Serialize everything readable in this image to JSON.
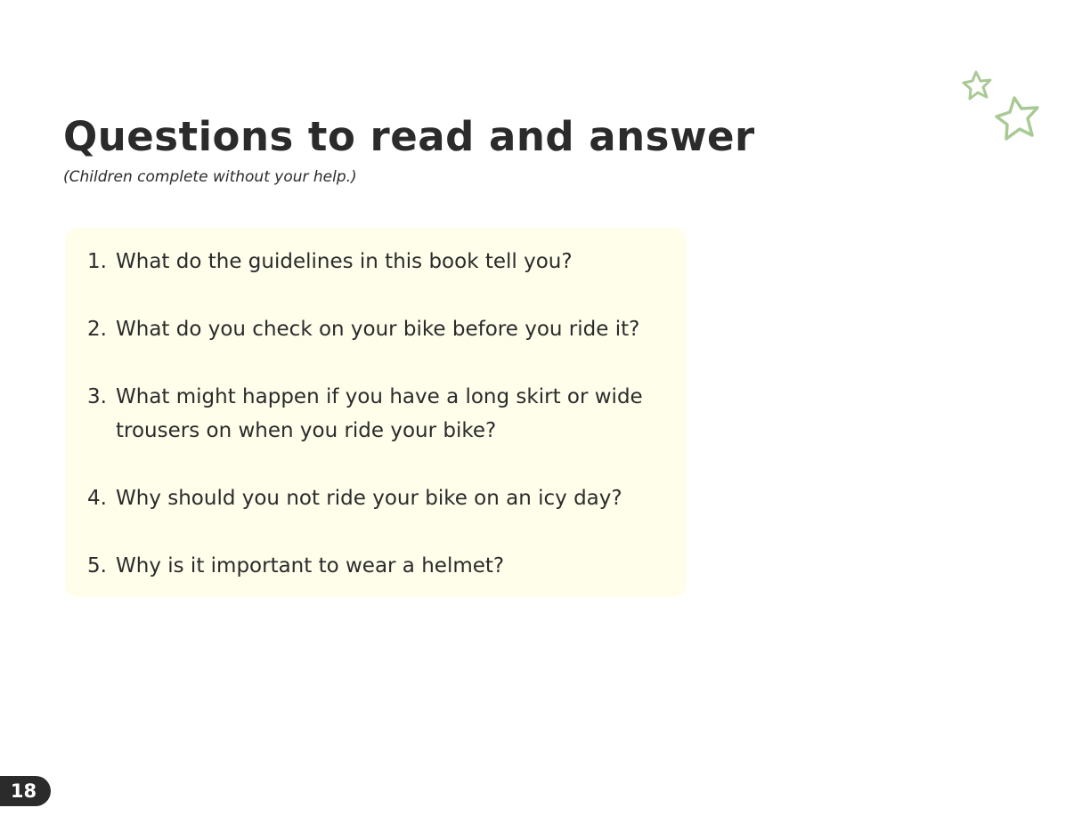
{
  "title": "Questions to read and answer",
  "subtitle": "(Children complete without your help.)",
  "questions": [
    {
      "number": "1.",
      "text": "What do the guidelines in this book tell you?"
    },
    {
      "number": "2.",
      "text": "What do you check on your bike before you ride it?"
    },
    {
      "number": "3.",
      "text": "What might happen if you have a long skirt or wide trousers on when you ride your bike?"
    },
    {
      "number": "4.",
      "text": "Why should you not ride your bike on an icy day?"
    },
    {
      "number": "5.",
      "text": "Why is it important to wear a helmet?"
    }
  ],
  "page_number": "18",
  "colors": {
    "text": "#2b2b2b",
    "panel_background": "#fffeeb",
    "star_outline": "#a9c995",
    "page_badge": "#2b2b2b"
  },
  "decoration": {
    "icons": [
      "star-outline-icon",
      "star-outline-icon"
    ]
  }
}
